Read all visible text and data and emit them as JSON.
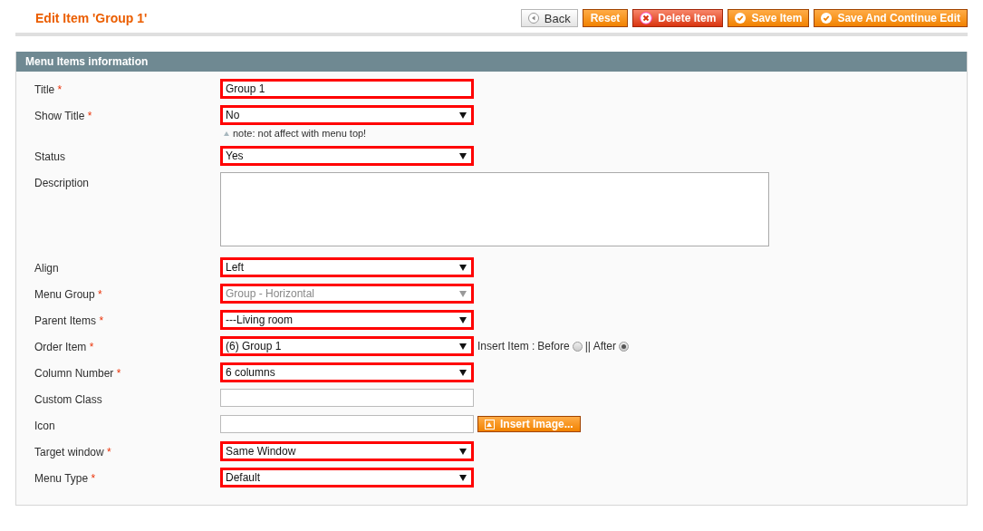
{
  "page": {
    "title": "Edit Item 'Group 1'"
  },
  "buttons": [
    {
      "label": "Back",
      "kind": "back"
    },
    {
      "label": "Reset",
      "kind": "plain"
    },
    {
      "label": "Delete Item",
      "kind": "delete"
    },
    {
      "label": "Save Item",
      "kind": "save"
    },
    {
      "label": "Save And Continue Edit",
      "kind": "save"
    }
  ],
  "section": {
    "title": "Menu Items information"
  },
  "fields": [
    {
      "label": "Title",
      "required_mark": "*",
      "kind": "text",
      "value": "Group 1",
      "highlighted": true
    },
    {
      "label": "Show Title",
      "required_mark": "*",
      "kind": "select",
      "value": "No",
      "highlighted": true,
      "note": "note: not affect with menu top!"
    },
    {
      "label": "Status",
      "kind": "select",
      "value": "Yes",
      "highlighted": true
    },
    {
      "label": "Description",
      "kind": "textarea",
      "highlighted": false
    },
    {
      "label": "Align",
      "kind": "select",
      "value": "Left",
      "highlighted": true
    },
    {
      "label": "Menu Group",
      "required_mark": "*",
      "kind": "select",
      "value": "Group - Horizontal",
      "highlighted": true,
      "disabled": true
    },
    {
      "label": "Parent Items",
      "required_mark": "*",
      "kind": "select",
      "value": "---Living room",
      "highlighted": true
    },
    {
      "label": "Order Item",
      "required_mark": "*",
      "kind": "select",
      "value": "(6) Group 1",
      "highlighted": true,
      "insert": {
        "prefix": "Insert Item :",
        "options": [
          {
            "label": "Before",
            "selected": false
          },
          {
            "label": "|| After",
            "selected": true
          }
        ]
      }
    },
    {
      "label": "Column Number",
      "required_mark": "*",
      "kind": "select",
      "value": "6 columns",
      "highlighted": true
    },
    {
      "label": "Custom Class",
      "kind": "text",
      "highlighted": false
    },
    {
      "label": "Icon",
      "kind": "text",
      "highlighted": false,
      "action": "Insert Image..."
    },
    {
      "label": "Target window",
      "required_mark": "*",
      "kind": "select",
      "value": "Same Window",
      "highlighted": true
    },
    {
      "label": "Menu Type",
      "required_mark": "*",
      "kind": "select",
      "value": "Default",
      "highlighted": true
    }
  ]
}
